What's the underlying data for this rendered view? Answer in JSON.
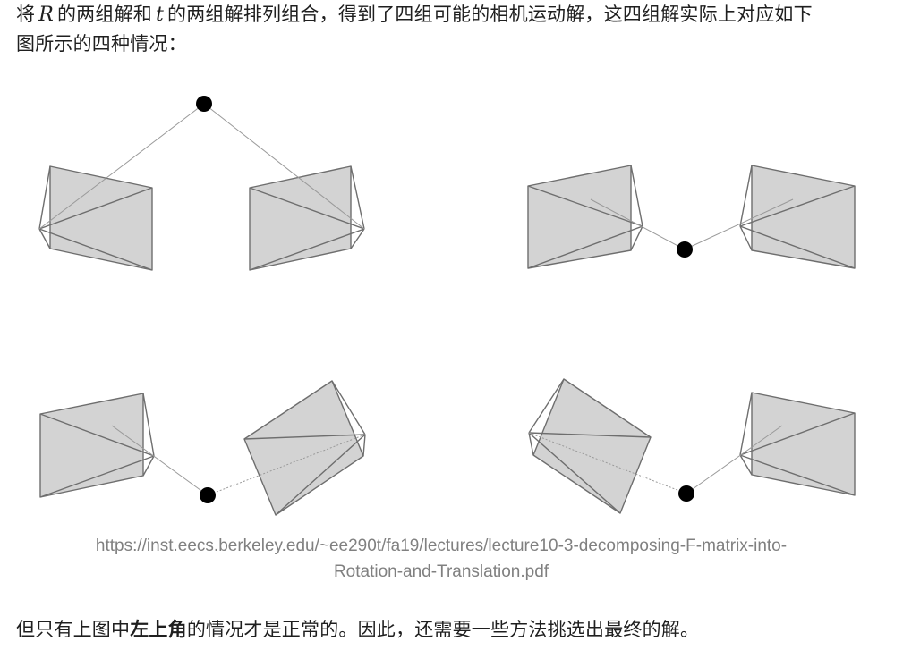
{
  "para1": {
    "t1": "将",
    "var_r": "R",
    "t2": "的两组解和",
    "var_t": "t",
    "t3": "的两组解排列组合，得到了四组可能的相机运动解，这四组解实际上对应如下",
    "line2": "图所示的四种情况："
  },
  "caption": {
    "line1": "https://inst.eecs.berkeley.edu/~ee290t/fa19/lectures/lecture10-3-decomposing-F-matrix-into-",
    "line2": "Rotation-and-Translation.pdf"
  },
  "para2": {
    "t1": "但只有上图中",
    "bold": "左上角",
    "t2": "的情况才是正常的。因此，还需要一些方法挑选出最终的解。"
  },
  "colors": {
    "text": "#1f1f1f",
    "caption": "#808080",
    "camera_fill": "#d3d3d3",
    "camera_edge": "#6e6e6e",
    "ray": "#9a9a9a",
    "point": "#000000"
  },
  "figure": {
    "panels": [
      "top-left",
      "top-right",
      "bottom-left",
      "bottom-right"
    ]
  }
}
